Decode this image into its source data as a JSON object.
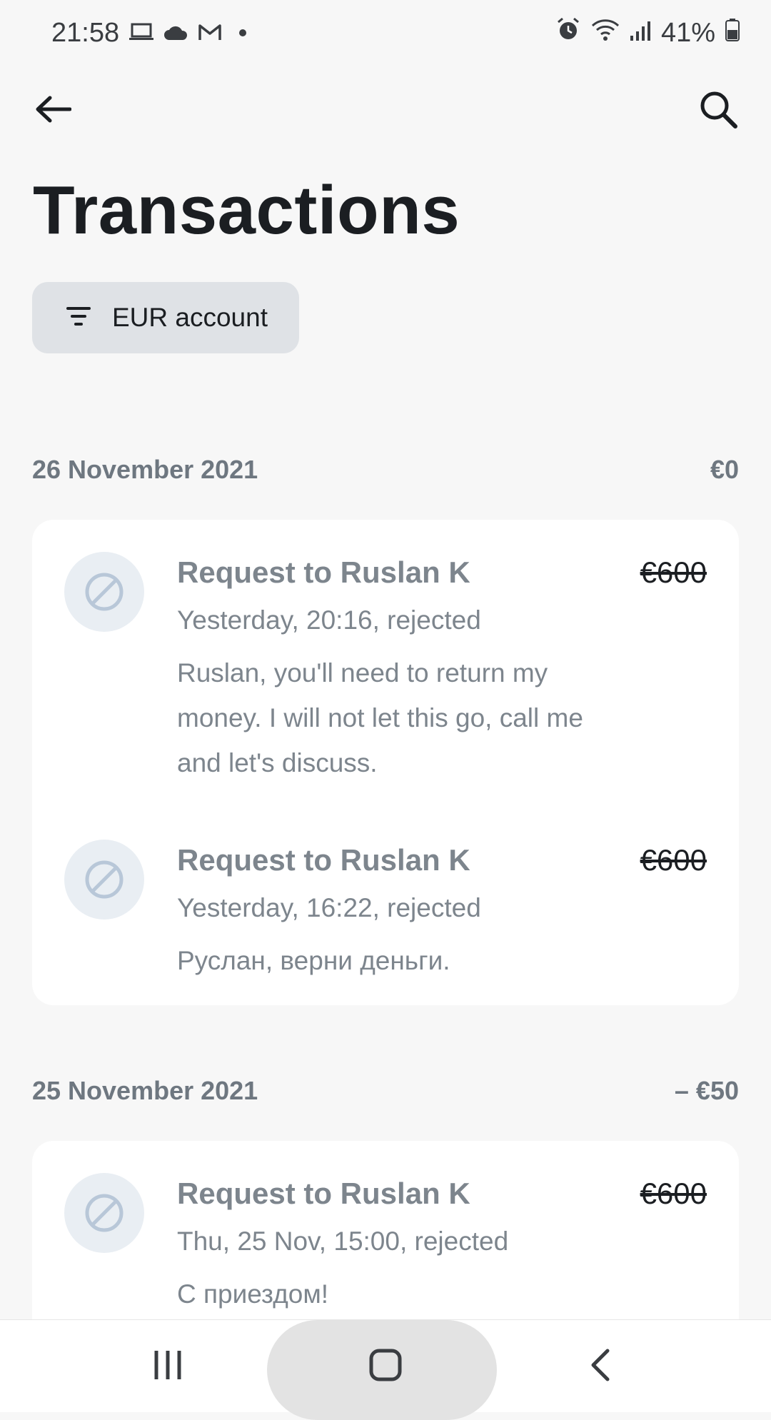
{
  "status_bar": {
    "time": "21:58",
    "left_icons": [
      "laptop-icon",
      "cloud-icon",
      "gmail-icon",
      "dot-icon"
    ],
    "right_icons": [
      "alarm-icon",
      "wifi-icon",
      "signal-icon",
      "battery-icon"
    ],
    "battery": "41%"
  },
  "header": {
    "back_icon": "arrow-left-icon",
    "search_icon": "search-icon",
    "title": "Transactions"
  },
  "filter_chip": {
    "icon": "filter-icon",
    "label": "EUR account"
  },
  "groups": [
    {
      "date": "26 November 2021",
      "total": "€0",
      "transactions": [
        {
          "icon": "rejected-icon",
          "title": "Request to Ruslan K",
          "amount": "€600",
          "meta": "Yesterday, 20:16, rejected",
          "note": "Ruslan, you'll need to return my money. I will not let this go, call me and let's discuss."
        },
        {
          "icon": "rejected-icon",
          "title": "Request to Ruslan K",
          "amount": "€600",
          "meta": "Yesterday, 16:22, rejected",
          "note": "Руслан, верни деньги."
        }
      ]
    },
    {
      "date": "25 November 2021",
      "total": "– €50",
      "transactions": [
        {
          "icon": "rejected-icon",
          "title": "Request to Ruslan K",
          "amount": "€600",
          "meta": "Thu, 25 Nov, 15:00, rejected",
          "note": "С приездом!"
        }
      ]
    }
  ],
  "nav_bar": {
    "items": [
      "recent-apps-icon",
      "home-icon",
      "back-icon"
    ]
  },
  "colors": {
    "background": "#f7f7f7",
    "chip": "#dfe2e6",
    "muted_text": "#7d858d",
    "avatar_bg": "#e9eef3",
    "rejected_icon": "#b8c7d8"
  }
}
